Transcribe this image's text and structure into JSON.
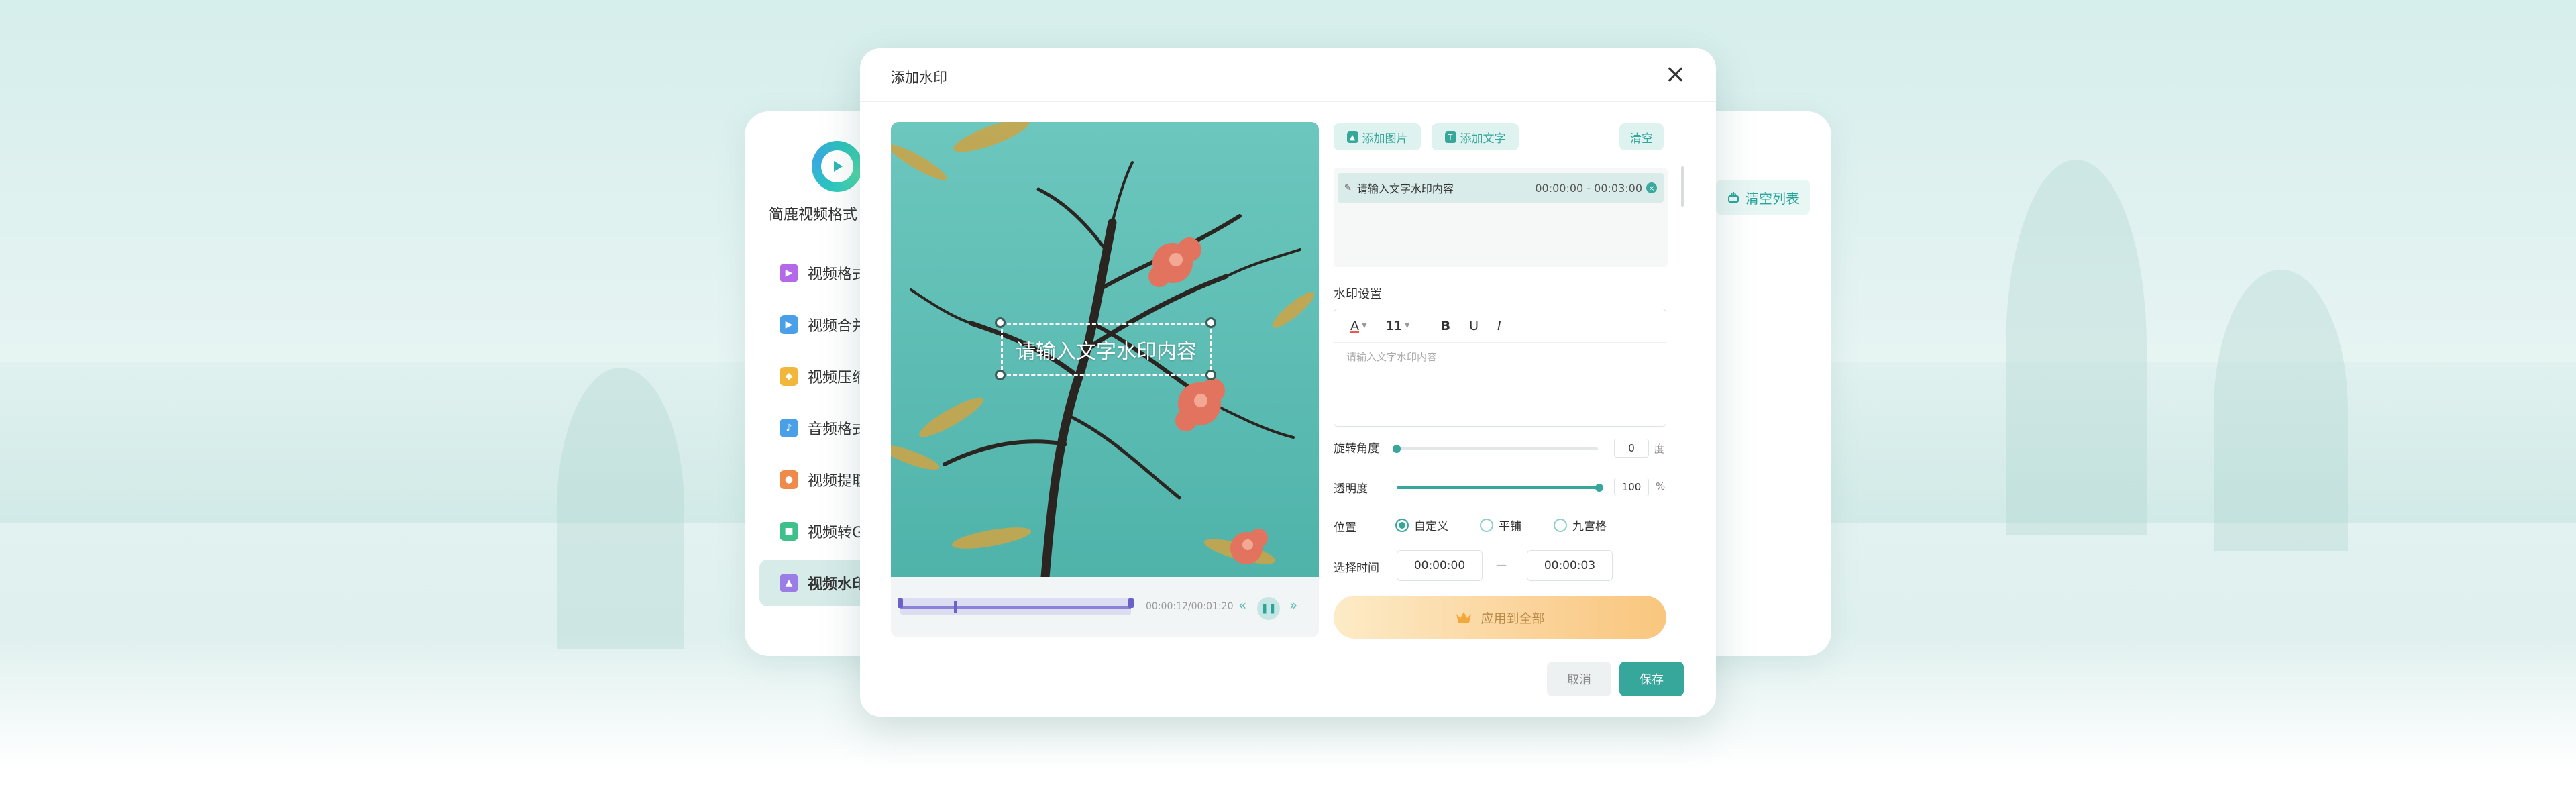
{
  "app": {
    "name": "简鹿视频格式"
  },
  "sidebar": {
    "items": [
      {
        "label": "视频格式",
        "icon": "video-format-icon",
        "color": "#b469e8"
      },
      {
        "label": "视频合并",
        "icon": "video-merge-icon",
        "color": "#4aa0e8"
      },
      {
        "label": "视频压缩",
        "icon": "video-compress-icon",
        "color": "#f2b63a"
      },
      {
        "label": "音频格式",
        "icon": "audio-format-icon",
        "color": "#4aa0e8"
      },
      {
        "label": "视频提取",
        "icon": "video-extract-icon",
        "color": "#f08a4b"
      },
      {
        "label": "视频转GIF",
        "icon": "video-gif-icon",
        "color": "#3fc08a"
      },
      {
        "label": "视频水印",
        "icon": "video-watermark-icon",
        "color": "#9b7de6",
        "active": true
      }
    ],
    "clear_list": "清空列表"
  },
  "dialog": {
    "title": "添加水印",
    "watermark_preview_text": "请输入文字水印内容",
    "player": {
      "time": "00:00:12/00:01:20"
    },
    "actions": {
      "add_image": "添加图片",
      "add_text": "添加文字",
      "clear": "清空"
    },
    "list": [
      {
        "text": "请输入文字水印内容",
        "range": "00:00:00 - 00:03:00"
      }
    ],
    "settings": {
      "title": "水印设置",
      "font_size": "11",
      "bold": "B",
      "underline": "U",
      "italic": "I",
      "text_placeholder": "请输入文字水印内容",
      "rotation": {
        "label": "旋转角度",
        "value": "0",
        "unit": "度"
      },
      "opacity": {
        "label": "透明度",
        "value": "100",
        "unit": "%"
      },
      "position": {
        "label": "位置",
        "options": [
          "自定义",
          "平铺",
          "九宫格"
        ],
        "selected": "自定义"
      },
      "time": {
        "label": "选择时间",
        "start": "00:00:00",
        "separator": "—",
        "end": "00:00:03"
      }
    },
    "apply_all": "应用到全部",
    "cancel": "取消",
    "save": "保存"
  },
  "colors": {
    "accent": "#37a69b",
    "apply_gradient_start": "#fdebc7",
    "apply_gradient_end": "#f9c67d",
    "timeline": "#8a83d6"
  }
}
